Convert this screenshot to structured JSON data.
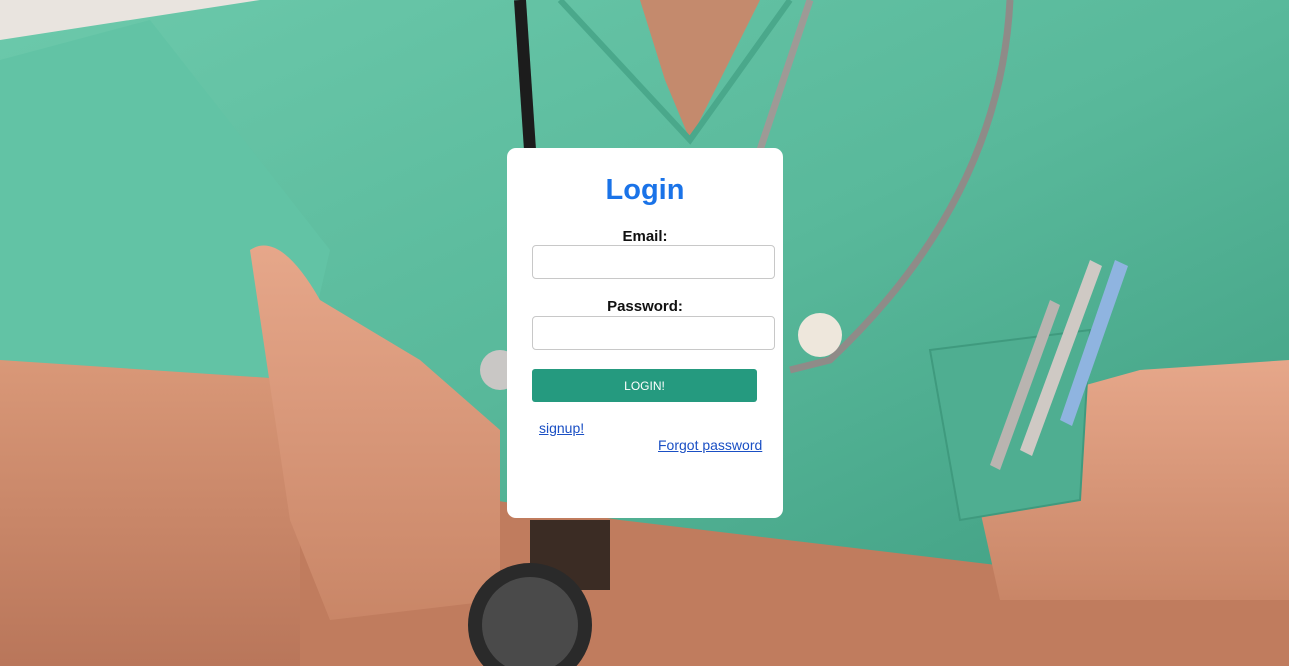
{
  "login_card": {
    "title": "Login",
    "email_label": "Email:",
    "email_value": "",
    "password_label": "Password:",
    "password_value": "",
    "login_button": "LOGIN!",
    "signup_link": "signup!",
    "forgot_link": "Forgot password"
  },
  "colors": {
    "title": "#1a73e8",
    "button": "#259a7f",
    "link": "#1a4fc4",
    "scrubs": "#5fbfa2"
  }
}
